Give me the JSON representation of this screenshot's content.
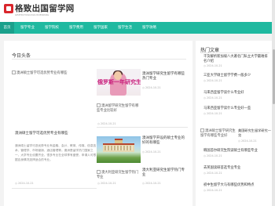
{
  "site": {
    "title": "格致出国留学网",
    "subtitle": "GEZHICHUGUOLIUXUEWANG"
  },
  "nav": {
    "items": [
      {
        "label": "首页",
        "active": true
      },
      {
        "label": "留学专业",
        "active": false
      },
      {
        "label": "留学院校",
        "active": false
      },
      {
        "label": "留学费用",
        "active": false
      },
      {
        "label": "留学国家",
        "active": false
      },
      {
        "label": "留学生活",
        "active": false
      },
      {
        "label": "留学攻略",
        "active": false
      }
    ]
  },
  "main": {
    "section_title": "今日头条",
    "headline": {
      "image_alt": "澳洲硕士留学可选优势专业有哪些",
      "title": "澳洲硕士留学可选优势专业有哪些",
      "desc": "澳洲硕士留学可选优势专业有金融、会计、教育、传媒、信息技术、管理学、市场营销、酒店管理等。澳洲是留学热门国家之一，大学专业设置齐全，很多专业在全球享有盛誉，申请人可根据自身情况选择适合的专业。",
      "time": "2024-10-21"
    },
    "cards": [
      {
        "photo_caption": "俄罗斯一年研究生",
        "title": "澳洲留学研究生留学有哪些热门专业",
        "time": "2024-10-21",
        "sub_alt": "澳洲留学研究生留学有哪些专业比较好",
        "sub_time": "2024-10-21"
      },
      {
        "title": "澳洲留学开设的硕士专业的好的有哪些",
        "time": "2024-10-21",
        "sub_alt": "澳大利亚研究生留学热门专业",
        "sub_time": "2024-10-21",
        "sub_title": "澳大利亚研究生留学热门专业"
      }
    ]
  },
  "side": {
    "title": "热门文章",
    "links": [
      {
        "text": "干货解析新加坡八大著名门私立大学最难排名介绍",
        "time": "2024-10-21"
      },
      {
        "text": "三亚大学硕士留学学费一般多少",
        "time": "2024-10-21"
      },
      {
        "text": "马来西亚留学读什么专业好",
        "time": "2024-10-21"
      },
      {
        "text": "马来西亚留学读什么专业好一些",
        "time": "2024-10-21"
      }
    ],
    "feature": {
      "image_alt": "澳洲硕士留学研究生留学有哪些专业好",
      "title": "美国研究生留学研究一览",
      "time": "2024-10-21"
    },
    "links2": [
      {
        "text": "韩国首尔研究生院读硕士有哪些专业",
        "time": "2024-10-21"
      },
      {
        "text": "去英国读研首选专业专业",
        "time": "2024-10-21"
      },
      {
        "text": "初中生留学大马有哪些优势和特点",
        "time": "2024-10-21"
      }
    ]
  },
  "colors": {
    "accent": "#1fb9a0",
    "accent_dark": "#1aa08b",
    "brand_red": "#d9262c"
  },
  "icons": {
    "logo": "logo-mark-icon",
    "clock": "clock-icon"
  }
}
